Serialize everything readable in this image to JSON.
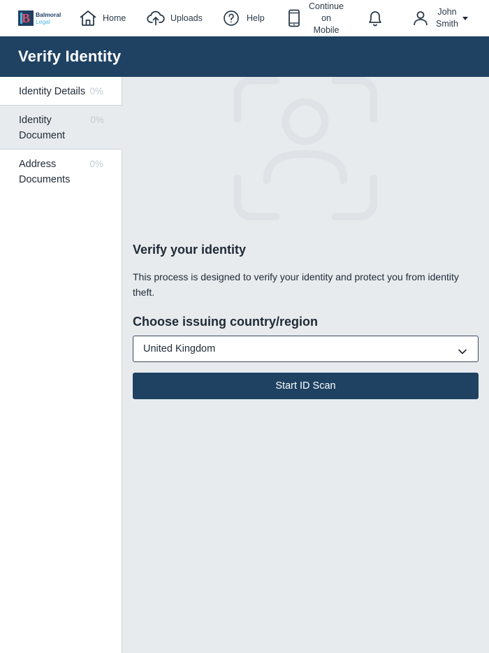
{
  "brand": {
    "line1": "Balmoral",
    "line2": "Legal",
    "mark_letter": "B"
  },
  "nav": {
    "home": {
      "label": "Home",
      "icon": "home-icon"
    },
    "uploads": {
      "label": "Uploads",
      "icon": "upload-cloud-icon"
    },
    "help": {
      "label": "Help",
      "icon": "help-circle-icon"
    },
    "mobile": {
      "lines": [
        "Continue",
        "on",
        "Mobile"
      ],
      "icon": "mobile-phone-icon"
    },
    "notifications": {
      "icon": "bell-icon"
    },
    "user": {
      "first": "John",
      "last": "Smith",
      "icon": "user-icon"
    }
  },
  "page": {
    "title": "Verify Identity"
  },
  "sidebar": {
    "items": [
      {
        "label": "Identity Details",
        "percent": "0%",
        "active": false
      },
      {
        "label": "Identity Document",
        "percent": "0%",
        "active": true
      },
      {
        "label": "Address Documents",
        "percent": "0%",
        "active": false
      }
    ]
  },
  "main": {
    "hero_icon": "camera-scan-icon",
    "heading": "Verify your identity",
    "description": "This process is designed to verify your identity and protect you from identity theft.",
    "country_label": "Choose issuing country/region",
    "country_select": {
      "value": "United Kingdom"
    },
    "start_button": "Start ID Scan"
  },
  "colors": {
    "primary": "#1f4263",
    "background": "#e8ebee",
    "brand_pink": "#e34f6a",
    "brand_blue": "#4ab7e0",
    "muted": "#c3cbd3"
  }
}
